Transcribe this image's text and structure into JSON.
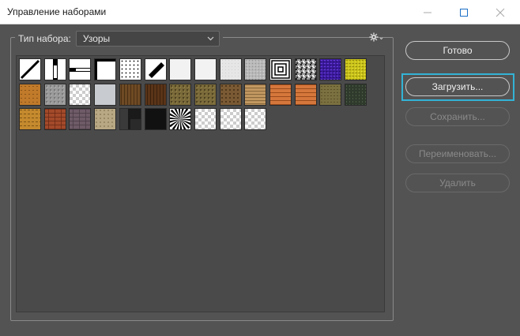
{
  "window": {
    "title": "Управление наборами"
  },
  "preset_type": {
    "label": "Тип набора:",
    "selected": "Узоры"
  },
  "buttons": {
    "done": "Готово",
    "load": "Загрузить...",
    "save": "Сохранить...",
    "rename": "Переименовать...",
    "delete": "Удалить"
  },
  "patterns": [
    {
      "style": "diag-line-white"
    },
    {
      "style": "vbar"
    },
    {
      "style": "hbar"
    },
    {
      "style": "frame-corner"
    },
    {
      "style": "dots"
    },
    {
      "style": "diag-block"
    },
    {
      "style": "white-smooth"
    },
    {
      "style": "white-smooth"
    },
    {
      "style": "light-noise"
    },
    {
      "style": "gray-noise"
    },
    {
      "style": "concentric-squares"
    },
    {
      "style": "bw-noise"
    },
    {
      "style": "purple-noise"
    },
    {
      "style": "yellow-noise"
    },
    {
      "style": "orange-rough"
    },
    {
      "style": "stone-gray"
    },
    {
      "style": "transparent"
    },
    {
      "style": "light-gray"
    },
    {
      "style": "brown-wood"
    },
    {
      "style": "brown-wood-dark"
    },
    {
      "style": "olive-rock"
    },
    {
      "style": "olive-rock"
    },
    {
      "style": "brown-rock"
    },
    {
      "style": "tan-stripes"
    },
    {
      "style": "orange-planks"
    },
    {
      "style": "orange-brick"
    },
    {
      "style": "olive-dirt"
    },
    {
      "style": "dark-green"
    },
    {
      "style": "gold-rough"
    },
    {
      "style": "red-brick"
    },
    {
      "style": "purple-gray-brick"
    },
    {
      "style": "beige-stone"
    },
    {
      "style": "black-gradient"
    },
    {
      "style": "black"
    },
    {
      "style": "radial-burst"
    },
    {
      "style": "transparent"
    },
    {
      "style": "transparent"
    },
    {
      "style": "transparent"
    }
  ]
}
